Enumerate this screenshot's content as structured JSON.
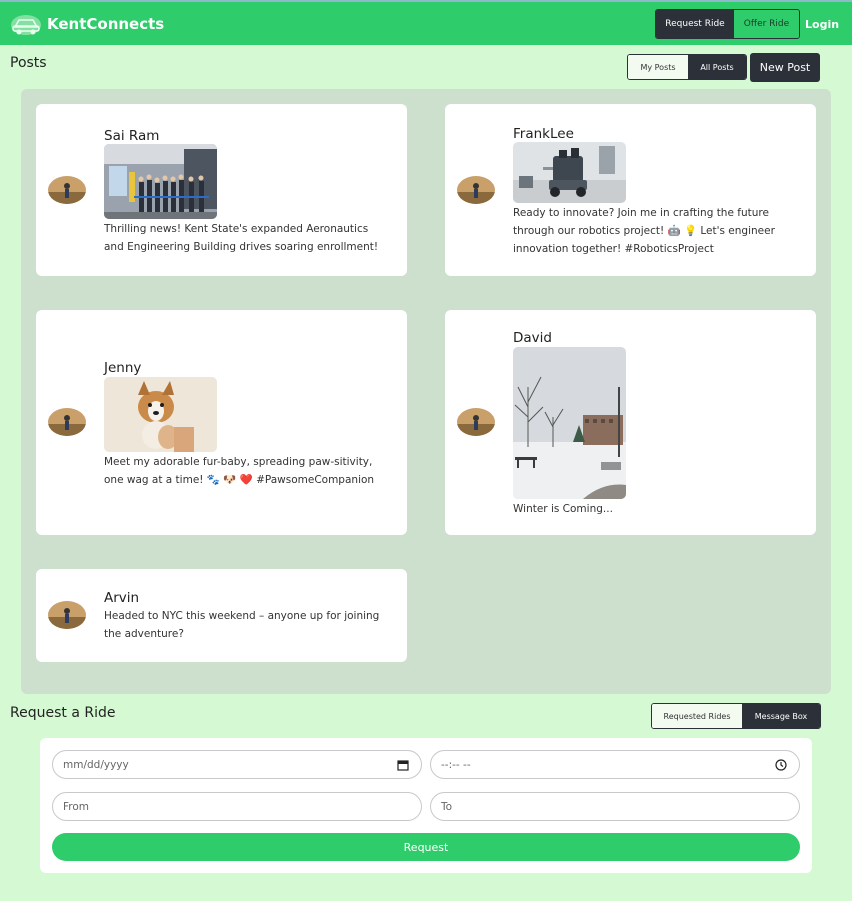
{
  "navbar": {
    "brand": "KentConnects",
    "request_ride": "Request Ride",
    "offer_ride": "Offer Ride",
    "login": "Login",
    "accent_color": "#2ecc6b"
  },
  "posts_section": {
    "title": "Posts",
    "my_posts": "My Posts",
    "all_posts": "All Posts",
    "new_post": "New Post"
  },
  "posts": [
    {
      "name": "Sai Ram",
      "text_lines": [
        "Thrilling news! Kent State's expanded Aeronautics",
        "and Engineering Building drives soaring enrollment!"
      ],
      "image": "ribbon-cutting-photo"
    },
    {
      "name": "FrankLee",
      "text_lines": [
        "Ready to innovate? Join me in crafting the future",
        "through our robotics project! 🤖 💡  Let's engineer",
        "innovation together! #RoboticsProject"
      ],
      "image": "robot-photo"
    },
    {
      "name": "Jenny",
      "text_lines": [
        "Meet my adorable fur-baby, spreading paw-sitivity,",
        "one wag at a time! 🐾 🐶 ❤️  #PawsomeCompanion"
      ],
      "image": "puppy-photo"
    },
    {
      "name": "David",
      "text_lines": [
        "Winter is Coming..."
      ],
      "image": "snow-campus-photo"
    },
    {
      "name": "Arvin",
      "text_lines": [
        "Headed to NYC this weekend – anyone up for joining",
        "the adventure?"
      ],
      "image": null
    }
  ],
  "ride_section": {
    "title": "Request a Ride",
    "requested_rides": "Requested Rides",
    "message_box": "Message Box",
    "date_placeholder": "mm/dd/yyyy",
    "time_placeholder": "--:-- --",
    "from_placeholder": "From",
    "to_placeholder": "To",
    "request_button": "Request"
  }
}
